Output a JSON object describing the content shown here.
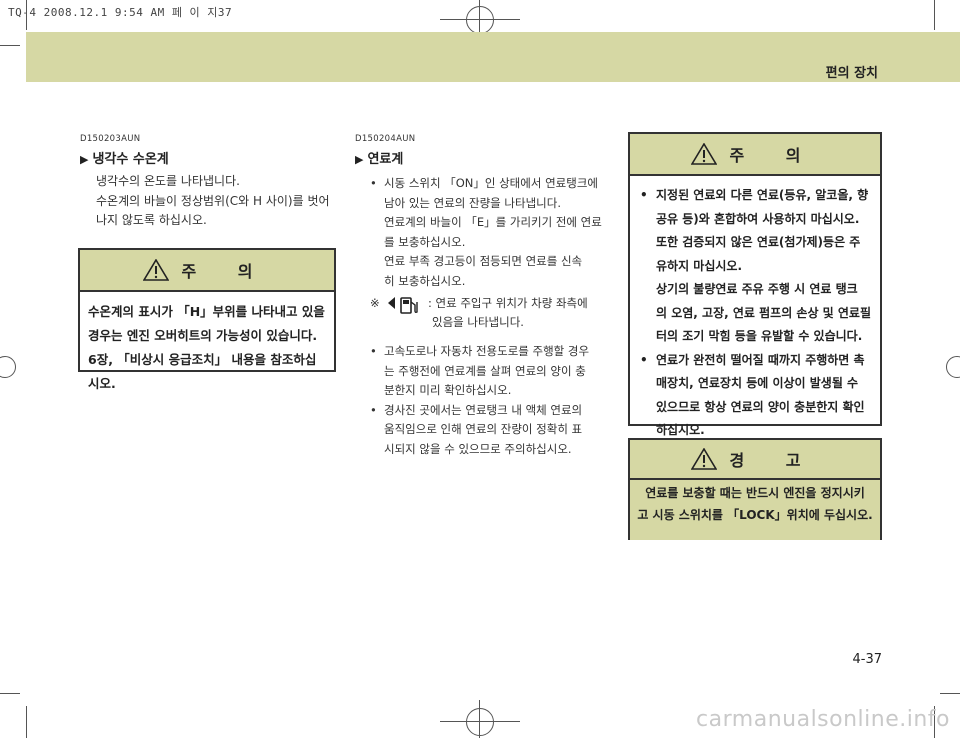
{
  "print_header": "TQ-4 2008.12.1 9:54 AM 페 이 지37",
  "band_title": "편의 장치",
  "left": {
    "code": "D150203AUN",
    "heading": "냉각수 수온계",
    "para": [
      "냉각수의 온도를 나타냅니다.",
      "수온계의 바늘이 정상범위(C와 H 사이)를 벗어",
      "나지 않도록 하십시오."
    ],
    "caution": {
      "title": "주 의",
      "lines": [
        "수온계의 표시가 「H」부위를 나타내고 있을",
        "경우는 엔진 오버히트의 가능성이 있습니다.",
        "6장, 「비상시 응급조치」 내용을 참조하십시오."
      ]
    }
  },
  "middle": {
    "code": "D150204AUN",
    "heading": "연료계",
    "bullets1": [
      [
        "시동 스위치 「ON」인 상태에서 연료탱크에",
        "남아 있는 연료의 잔량을 나타냅니다.",
        "연료계의 바늘이 「E」를 가리키기 전에 연료",
        "를 보충하십시오.",
        "연료 부족 경고등이 점등되면 연료를 신속",
        "히 보충하십시오."
      ]
    ],
    "note_mark": "※",
    "note_lines": [
      ": 연료 주입구 위치가 차량 좌측에",
      "있음을 나타냅니다."
    ],
    "bullets2": [
      [
        "고속도로나 자동차 전용도로를 주행할 경우",
        "는 주행전에 연료계를 살펴 연료의 양이 충",
        "분한지 미리 확인하십시오."
      ],
      [
        "경사진 곳에서는 연료탱크 내 액체 연료의",
        "움직임으로 인해 연료의 잔량이 정확히 표",
        "시되지 않을 수 있으므로 주의하십시오."
      ]
    ]
  },
  "right": {
    "caution": {
      "title": "주 의",
      "items": [
        [
          "지정된 연료외 다른 연료(등유, 알코올, 향",
          "공유 등)와 혼합하여 사용하지 마십시오.",
          "또한 검증되지 않은 연료(첨가제)등은 주",
          "유하지 마십시오.",
          "상기의 불량연료 주유 주행 시 연료 탱크",
          "의 오염, 고장, 연료 펌프의 손상 및 연료필",
          "터의 조기 막힘 등을 유발할 수 있습니다."
        ],
        [
          "연료가 완전히 떨어질 때까지 주행하면 촉",
          "매장치, 연료장치 등에 이상이 발생될 수",
          "있으므로 항상 연료의 양이 충분한지 확인",
          "하십시오."
        ]
      ]
    },
    "warning": {
      "title": "경 고",
      "lines": [
        "연료를 보충할 때는 반드시 엔진을 정지시키",
        "고 시동 스위치를 「LOCK」위치에 두십시오."
      ]
    }
  },
  "page_number": "4-37",
  "watermark": "carmanualsonline.info"
}
